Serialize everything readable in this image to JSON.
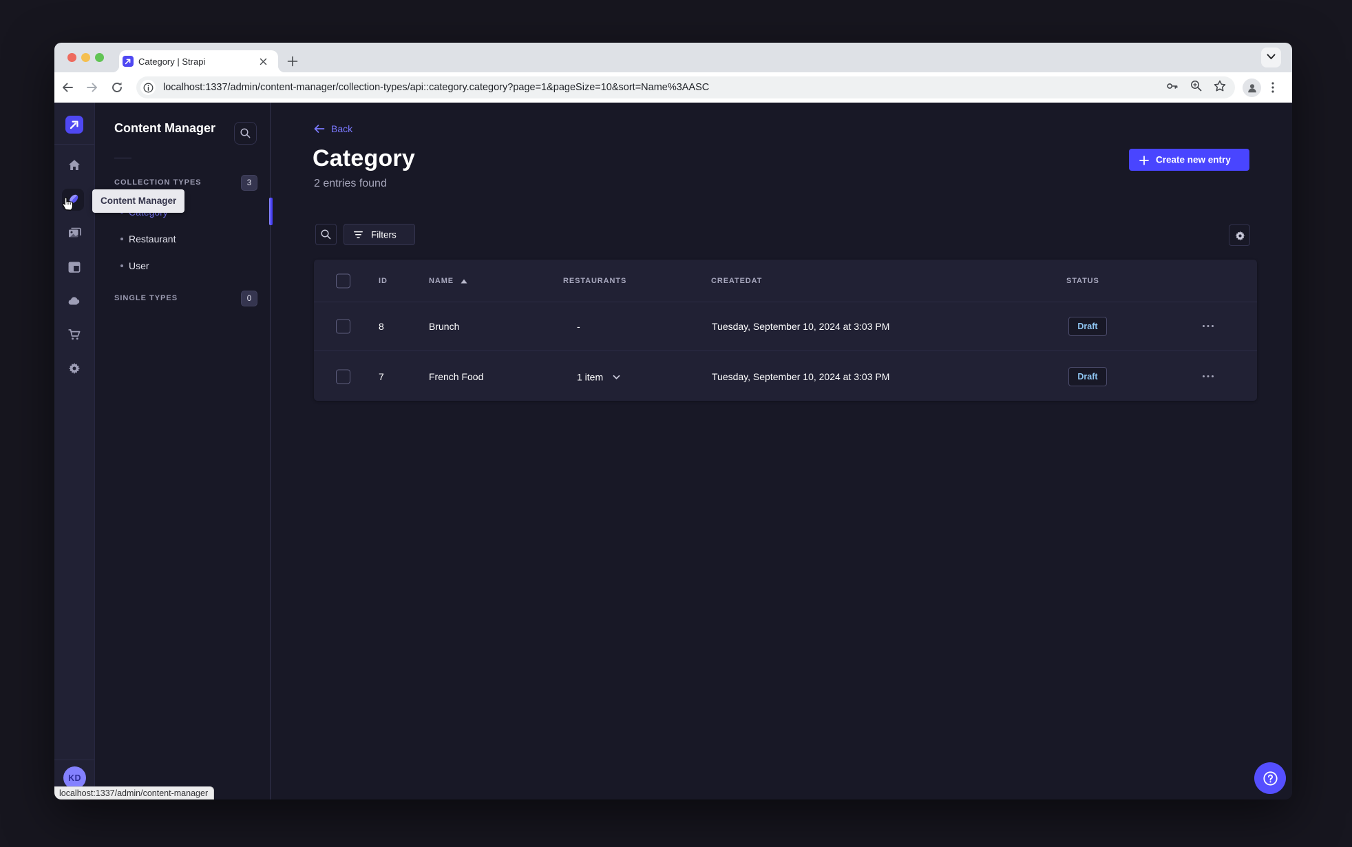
{
  "browser": {
    "tab": {
      "title": "Category | Strapi"
    },
    "url": "localhost:1337/admin/content-manager/collection-types/api::category.category?page=1&pageSize=10&sort=Name%3AASC",
    "status_bubble": "localhost:1337/admin/content-manager",
    "icons": [
      "back-icon",
      "forward-icon",
      "reload-icon",
      "info-icon",
      "key-icon",
      "zoom-icon",
      "star-icon",
      "profile-icon",
      "menu-icon",
      "new-tab-icon",
      "tab-search-icon",
      "close-icon"
    ]
  },
  "sidebar": {
    "logo_icon": "strapi-logo",
    "items": [
      "home-icon",
      "content-manager-icon",
      "media-library-icon",
      "content-type-builder-icon",
      "cloud-icon",
      "marketplace-icon",
      "settings-icon"
    ],
    "tooltip": "Content Manager",
    "avatar_initials": "KD"
  },
  "subnav": {
    "title": "Content Manager",
    "search_icon": "search-icon",
    "sections": [
      {
        "label": "COLLECTION TYPES",
        "badge": "3",
        "items": [
          {
            "label": "Category",
            "active": true
          },
          {
            "label": "Restaurant",
            "active": false
          },
          {
            "label": "User",
            "active": false
          }
        ]
      },
      {
        "label": "SINGLE TYPES",
        "badge": "0",
        "items": []
      }
    ]
  },
  "main": {
    "back_label": "Back",
    "title": "Category",
    "subtitle": "2 entries found",
    "create_button_label": "Create new entry",
    "filters_button_label": "Filters",
    "table": {
      "columns": [
        "ID",
        "NAME",
        "RESTAURANTS",
        "CREATEDAT",
        "STATUS"
      ],
      "sorted_by": "NAME",
      "sort_direction": "ascending",
      "rows": [
        {
          "id": "8",
          "name": "Brunch",
          "restaurants": "-",
          "createdat": "Tuesday, September 10, 2024 at 3:03 PM",
          "status": "Draft"
        },
        {
          "id": "7",
          "name": "French Food",
          "restaurants": "1 item",
          "createdat": "Tuesday, September 10, 2024 at 3:03 PM",
          "status": "Draft"
        }
      ]
    },
    "help_icon": "question-mark-icon"
  },
  "colors": {
    "primary": "#4945ff",
    "primary_light": "#7b79ff",
    "app_background": "#181826",
    "panel_background": "#212134",
    "draft_text": "#8fc6f3",
    "text_muted": "#a5a5ba",
    "backdrop": "#17161f",
    "chrome_tabstrip": "#dee1e6"
  }
}
